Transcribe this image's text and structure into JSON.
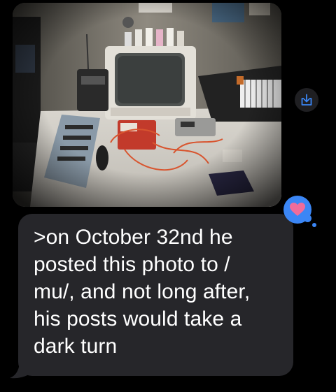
{
  "message": {
    "lines": [
      ">on October 32nd he",
      "posted this photo to /",
      "mu/, and not long after,",
      "his posts would take a",
      "dark turn"
    ]
  },
  "photo": {
    "description_icon": "photo-attachment"
  },
  "actions": {
    "save_icon": "download-icon"
  },
  "reaction": {
    "icon": "heart-icon",
    "color": "#3b86f5",
    "heart_color": "#f06c9b"
  },
  "colors": {
    "background": "#000000",
    "bubble": "#26262a",
    "text": "#ffffff",
    "accent": "#3b86f5"
  }
}
